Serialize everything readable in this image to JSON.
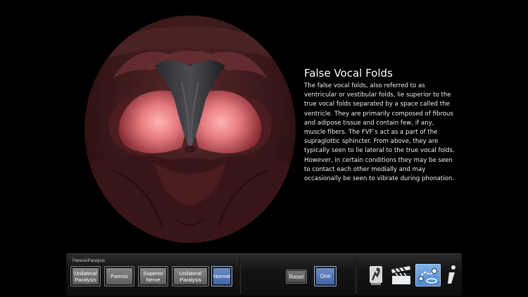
{
  "info": {
    "title": "False Vocal Folds",
    "body": "The false vocal folds, also referred to as ventricular or vestibular folds, lie superior to the true vocal folds separated by a space called the ventricle. They are primarily composed of fibrous and adipose tissue and contain  few, if any, muscle fibers.  The FVF’s act as a part of the supraglottic sphincter.  From above, they are typically seen to lie lateral to the true vocal folds.  However, in certain  conditions they may be seen to contact each other medially and may occasionally be seen to vibrate during phonation."
  },
  "toolbar": {
    "group_label": "Paresis/Paralysis",
    "buttons": {
      "unilateral_paralysis": "Unilateral\nParalysis",
      "paresis": "Paresis",
      "superior_nerve": "Superior\nNerve",
      "unilateral_paralysis_2": "Unilateral\nParalysis",
      "normal": "Normal"
    },
    "active": "Normal",
    "reset": "Reset",
    "one": "One",
    "tools": [
      "flexibility-tool-icon",
      "clapperboard-icon",
      "map-icon",
      "info-icon"
    ]
  },
  "colors": {
    "active_button": "#4a72b8",
    "tissue": "#5a2a2a",
    "fold_pink": "#e88a8e"
  }
}
